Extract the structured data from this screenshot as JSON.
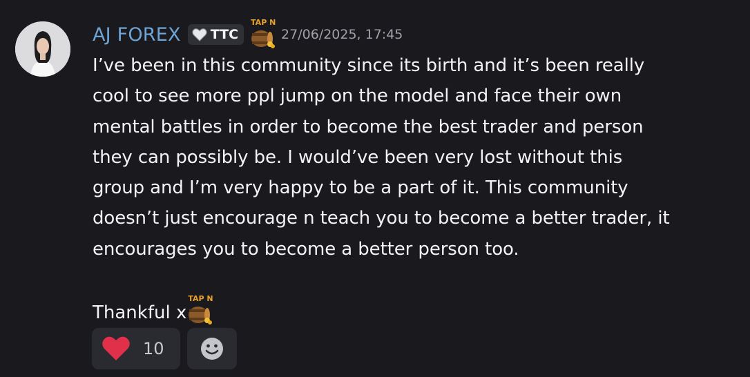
{
  "author": {
    "name": "AJ FOREX",
    "avatar_icon": "avatar-woman-photo",
    "name_color": "#6ea4d6"
  },
  "tag": {
    "icon": "white-heart-icon",
    "label": "TTC"
  },
  "emoji_label": "TAP N",
  "emoji_icon": "treasure-barrel-icon",
  "timestamp": "27/06/2025, 17:45",
  "message": {
    "text": "I’ve been in this community since its birth and it’s been really\ncool to see more ppl jump on the model and face their own\nmental battles in order to become the best trader and person\nthey can possibly be. I would’ve been very lost without this\ngroup and I’m very happy to be a part of it. This community\ndoesn’t just encourage n teach you to become a better trader, it\nencourages you to become a better person too.",
    "signoff": "Thankful x"
  },
  "reactions": {
    "heart_icon": "red-heart-icon",
    "heart_count": "10",
    "add_icon": "add-reaction-smiley-icon"
  },
  "colors": {
    "background": "#1a1a1e",
    "reaction_bg": "#2a2b30",
    "heart": "#e0304a",
    "tap_label": "#e6a22a"
  }
}
